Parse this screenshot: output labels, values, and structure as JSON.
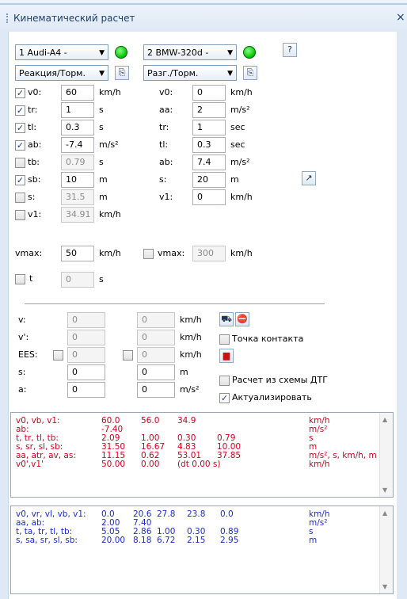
{
  "title": "Кинематический расчет",
  "close_glyph": "×",
  "vehicle1": {
    "selected": "1 Audi-A4 -",
    "mode": "Реакция/Торм."
  },
  "vehicle2": {
    "selected": "2 BMW-320d -",
    "mode": "Разг./Торм."
  },
  "help_glyph": "?",
  "left_params": [
    {
      "label": "v0:",
      "value": "60",
      "unit": "km/h",
      "checked": true,
      "enabled": true
    },
    {
      "label": "tr:",
      "value": "1",
      "unit": "s",
      "checked": true,
      "enabled": true
    },
    {
      "label": "tl:",
      "value": "0.3",
      "unit": "s",
      "checked": true,
      "enabled": true
    },
    {
      "label": "ab:",
      "value": "-7.4",
      "unit": "m/s²",
      "checked": true,
      "enabled": true
    },
    {
      "label": "tb:",
      "value": "0.79",
      "unit": "s",
      "checked": false,
      "enabled": false
    },
    {
      "label": "sb:",
      "value": "10",
      "unit": "m",
      "checked": true,
      "enabled": true
    },
    {
      "label": "s:",
      "value": "31.5",
      "unit": "m",
      "checked": false,
      "enabled": false
    },
    {
      "label": "v1:",
      "value": "34.91",
      "unit": "km/h",
      "checked": false,
      "enabled": false
    }
  ],
  "vmax_left": {
    "label": "vmax:",
    "value": "50",
    "unit": "km/h"
  },
  "t_param": {
    "label": "t",
    "value": "0",
    "unit": "s"
  },
  "right_params": [
    {
      "label": "v0:",
      "value": "0",
      "unit": "km/h"
    },
    {
      "label": "aa:",
      "value": "2",
      "unit": "m/s²"
    },
    {
      "label": "tr:",
      "value": "1",
      "unit": "sec"
    },
    {
      "label": "tl:",
      "value": "0.3",
      "unit": "sec"
    },
    {
      "label": "ab:",
      "value": "7.4",
      "unit": "m/s²"
    },
    {
      "label": "s:",
      "value": "20",
      "unit": "m"
    },
    {
      "label": "v1:",
      "value": "0",
      "unit": "km/h"
    }
  ],
  "vmax_right": {
    "label": "vmax:",
    "value": "300",
    "unit": "km/h"
  },
  "lower": [
    {
      "label": "v:",
      "v1": "0",
      "v2": "0",
      "unit": "km/h"
    },
    {
      "label": "v':",
      "v1": "0",
      "v2": "0",
      "unit": "km/h"
    },
    {
      "label": "EES:",
      "v1": "0",
      "v2": "0",
      "unit": "km/h"
    },
    {
      "label": "s:",
      "v1": "0",
      "v2": "0",
      "unit": "m"
    },
    {
      "label": "a:",
      "v1": "0",
      "v2": "0",
      "unit": "m/s²"
    }
  ],
  "options": {
    "contact_point": "Точка контакта",
    "calc_from_scheme": "Расчет из схемы ДТГ",
    "actualize": "Актуализировать"
  },
  "colors": {
    "result1": "#d4001a",
    "result2": "#1a2bd4",
    "accent": "#1e3e6e"
  },
  "results1": [
    {
      "name": "v0, vb, v1:",
      "vals": [
        "60.0",
        "56.0",
        "34.9",
        ""
      ],
      "unit": "km/h"
    },
    {
      "name": "ab:",
      "vals": [
        "-7.40",
        "",
        "",
        ""
      ],
      "unit": "m/s²"
    },
    {
      "name": "t, tr, tl, tb:",
      "vals": [
        "2.09",
        "1.00",
        "0.30",
        "0.79"
      ],
      "unit": "s"
    },
    {
      "name": "s, sr, sl, sb:",
      "vals": [
        "31.50",
        "16.67",
        "4.83",
        "10.00"
      ],
      "unit": "m"
    },
    {
      "name": "aa, atr, av, as:",
      "vals": [
        "11.15",
        "0.62",
        "53.01",
        "37.85"
      ],
      "unit": "m/s², s, km/h, m"
    },
    {
      "name": "v0',v1'",
      "vals": [
        "50.00",
        "0.00",
        "(dt 0.00 s)",
        ""
      ],
      "unit": "km/h"
    }
  ],
  "results2": [
    {
      "name": "v0, vr, vl, vb, v1:",
      "vals": [
        "0.0",
        "20.6",
        "27.8",
        "23.8",
        "0.0"
      ],
      "unit": "km/h"
    },
    {
      "name": "aa, ab:",
      "vals": [
        "2.00",
        "7.40",
        "",
        "",
        ""
      ],
      "unit": "m/s²"
    },
    {
      "name": "t, ta, tr, tl, tb:",
      "vals": [
        "5.05",
        "2.86",
        "1.00",
        "0.30",
        "0.89"
      ],
      "unit": "s"
    },
    {
      "name": "s, sa, sr, sl, sb:",
      "vals": [
        "20.00",
        "8.18",
        "6.72",
        "2.15",
        "2.95"
      ],
      "unit": "m"
    }
  ]
}
